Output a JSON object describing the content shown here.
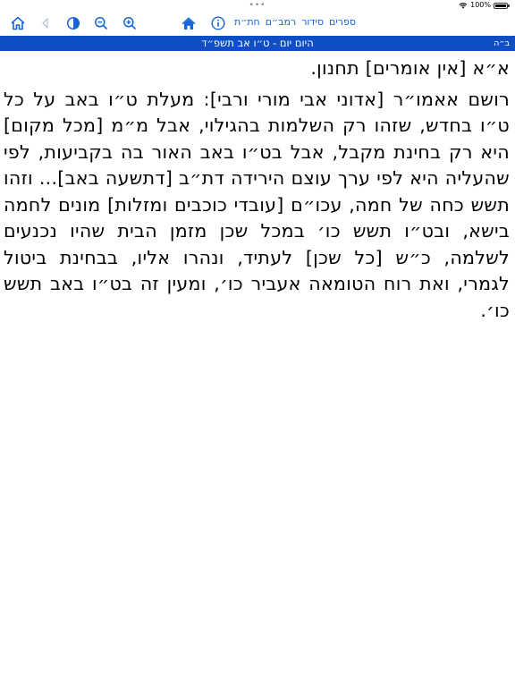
{
  "status": {
    "dots": "•••",
    "battery_text": "100%",
    "battery_level": 1.0
  },
  "toolbar": {
    "links": [
      "ספרים",
      "סידור",
      "רמב״ם",
      "חת״ת"
    ],
    "icons": [
      "home-icon",
      "contrast-icon",
      "zoom-out-icon",
      "zoom-in-icon",
      "back-arrow-icon",
      "home-icon",
      "info-icon"
    ]
  },
  "header": {
    "title": "היום יום - ט״ו אב תשפ״ד",
    "right_label": "ב״ה"
  },
  "content": {
    "paragraph_1": "א״א [אין אומרים] תחנון.",
    "paragraph_2": "רושם אאמו״ר [אדוני אבי מורי ורבי]: מעלת ט״ו באב על כל ט״ו בחדש, שזהו רק השלמות בהגילוי, אבל מ״מ [מכל מקום] היא רק בחינת מקבל, אבל בט״ו באב האור בה בקביעות, לפי שהעליה היא לפי ערך עוצם הירידה דת״ב [דתשעה באב]... וזהו תשש כחה של חמה, עכו״ם [עובדי כוכבים ומזלות] מונים לחמה בישא, ובט״ו תשש כו׳ במכל שכן מזמן הבית שהיו נכנעים לשלמה, כ״ש [כל שכן] לעתיד, ונהרו אליו, בבחינת ביטול לגמרי, ואת רוח הטומאה אעביר כו׳, ומעין זה בט״ו באב תשש כו׳."
  },
  "colors": {
    "accent": "#1565d8",
    "header_bar": "#0e4fc6",
    "disabled_icon": "#b8c4d8"
  }
}
